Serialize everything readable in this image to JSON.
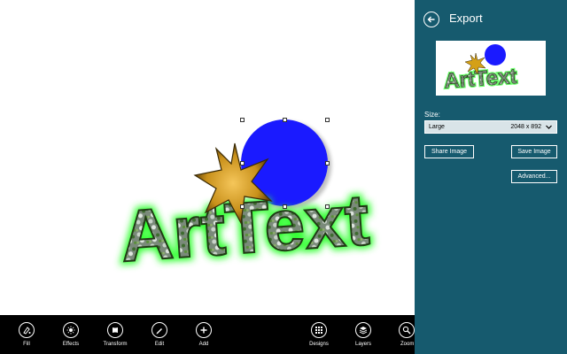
{
  "artwork": {
    "text": "ArtText"
  },
  "app_bar": {
    "buttons": [
      {
        "label": "Fill",
        "icon": "fill-icon"
      },
      {
        "label": "Effects",
        "icon": "effects-icon"
      },
      {
        "label": "Transform",
        "icon": "transform-icon"
      },
      {
        "label": "Edit",
        "icon": "edit-icon"
      },
      {
        "label": "Add",
        "icon": "add-icon"
      },
      {
        "label": "Designs",
        "icon": "designs-icon"
      },
      {
        "label": "Layers",
        "icon": "layers-icon"
      },
      {
        "label": "Zoom",
        "icon": "zoom-icon"
      }
    ]
  },
  "export_panel": {
    "title": "Export",
    "size_label": "Size:",
    "size_select": {
      "selected": "Large",
      "dimensions": "2048 x 892"
    },
    "share_button": "Share Image",
    "save_button": "Save Image",
    "advanced_button": "Advanced..."
  },
  "colors": {
    "panel_bg": "#165a6e",
    "app_bar_bg": "#000000",
    "circle": "#1a1aff",
    "glow": "#33ff33",
    "star": "#d4a017"
  }
}
